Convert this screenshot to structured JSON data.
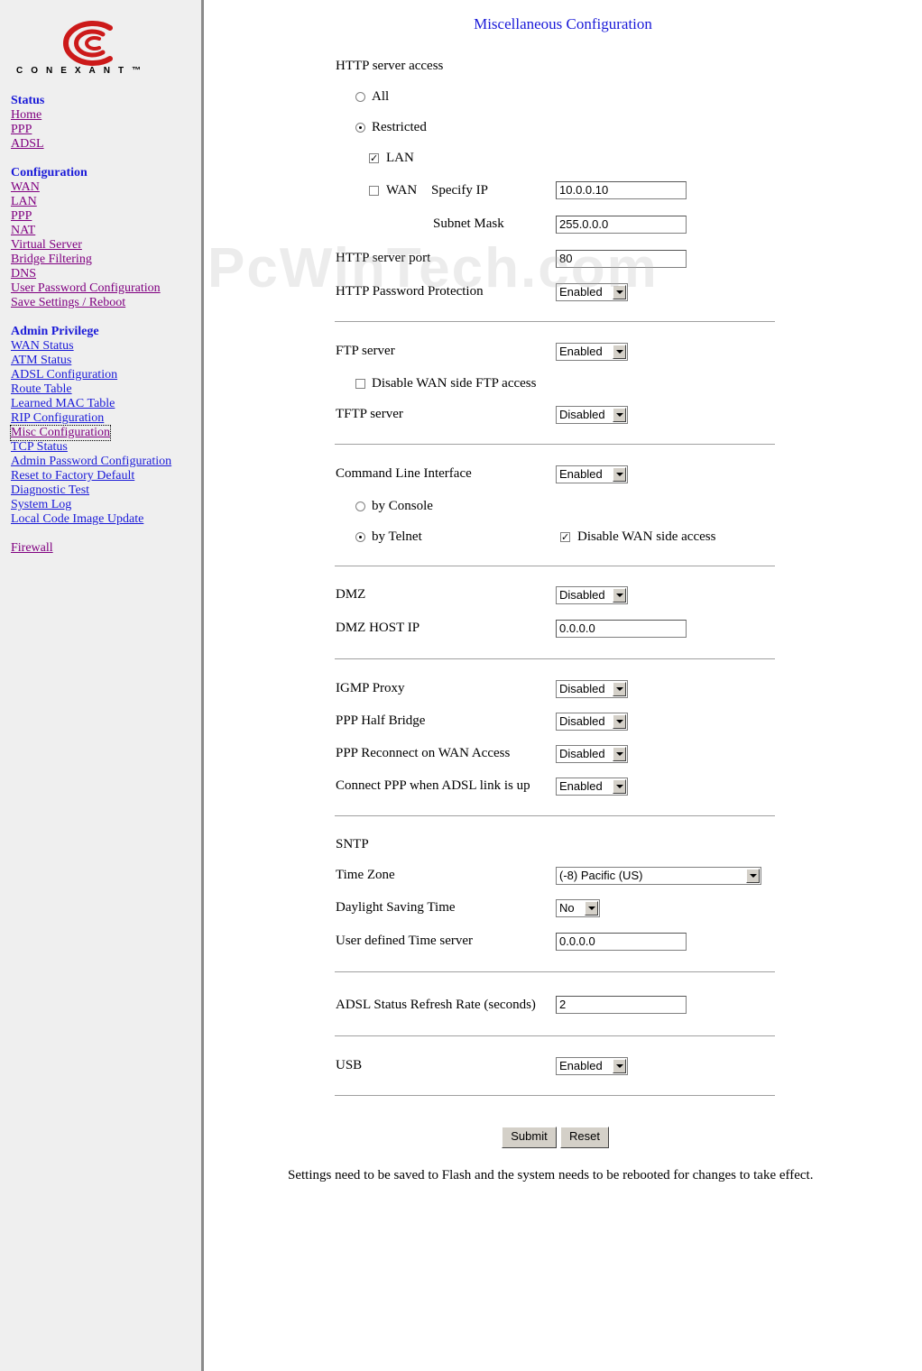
{
  "brand": {
    "logo_text": "CONEXANT™"
  },
  "sidebar": {
    "status_heading": "Status",
    "status_links": [
      "Home",
      "PPP",
      "ADSL"
    ],
    "config_heading": "Configuration",
    "config_links": [
      "WAN",
      "LAN",
      "PPP",
      "NAT",
      "Virtual Server",
      "Bridge Filtering",
      "DNS",
      "User Password Configuration",
      "Save Settings / Reboot"
    ],
    "admin_heading": "Admin Privilege",
    "admin_links": [
      "WAN Status",
      "ATM Status",
      "ADSL Configuration",
      "Route Table",
      "Learned MAC Table",
      "RIP Configuration",
      "Misc Configuration",
      "TCP Status",
      "Admin Password Configuration",
      "Reset to Factory Default",
      "Diagnostic Test",
      "System Log",
      "Local Code Image Update"
    ],
    "firewall_link": "Firewall"
  },
  "page": {
    "title": "Miscellaneous Configuration",
    "watermark": "PcWinTech.com"
  },
  "http": {
    "section_label": "HTTP server access",
    "all_label": "All",
    "restricted_label": "Restricted",
    "lan_label": "LAN",
    "wan_label": "WAN",
    "specify_ip_label": "Specify IP",
    "specify_ip_value": "10.0.0.10",
    "subnet_mask_label": "Subnet Mask",
    "subnet_mask_value": "255.0.0.0",
    "port_label": "HTTP server port",
    "port_value": "80",
    "password_protection_label": "HTTP Password Protection",
    "password_protection_value": "Enabled"
  },
  "ftp": {
    "label": "FTP server",
    "value": "Enabled",
    "disable_wan_label": "Disable WAN side FTP access",
    "tftp_label": "TFTP server",
    "tftp_value": "Disabled"
  },
  "cli": {
    "label": "Command Line Interface",
    "value": "Enabled",
    "console_label": "by Console",
    "telnet_label": "by Telnet",
    "disable_wan_label": "Disable WAN side access"
  },
  "dmz": {
    "label": "DMZ",
    "value": "Disabled",
    "host_ip_label": "DMZ HOST IP",
    "host_ip_value": "0.0.0.0"
  },
  "misc": {
    "igmp_label": "IGMP Proxy",
    "igmp_value": "Disabled",
    "ppp_half_bridge_label": "PPP Half Bridge",
    "ppp_half_bridge_value": "Disabled",
    "ppp_reconnect_label": "PPP Reconnect on WAN Access",
    "ppp_reconnect_value": "Disabled",
    "connect_ppp_label": "Connect PPP when ADSL link is up",
    "connect_ppp_value": "Enabled"
  },
  "sntp": {
    "label": "SNTP",
    "timezone_label": "Time Zone",
    "timezone_value": "(-8) Pacific (US)",
    "dst_label": "Daylight Saving Time",
    "dst_value": "No",
    "server_label": "User defined Time server",
    "server_value": "0.0.0.0"
  },
  "adsl": {
    "refresh_label": "ADSL Status Refresh Rate (seconds)",
    "refresh_value": "2"
  },
  "usb": {
    "label": "USB",
    "value": "Enabled"
  },
  "actions": {
    "submit_label": "Submit",
    "reset_label": "Reset"
  },
  "footer": {
    "note": "Settings need to be saved to Flash and the system needs to be rebooted for changes to take effect."
  }
}
